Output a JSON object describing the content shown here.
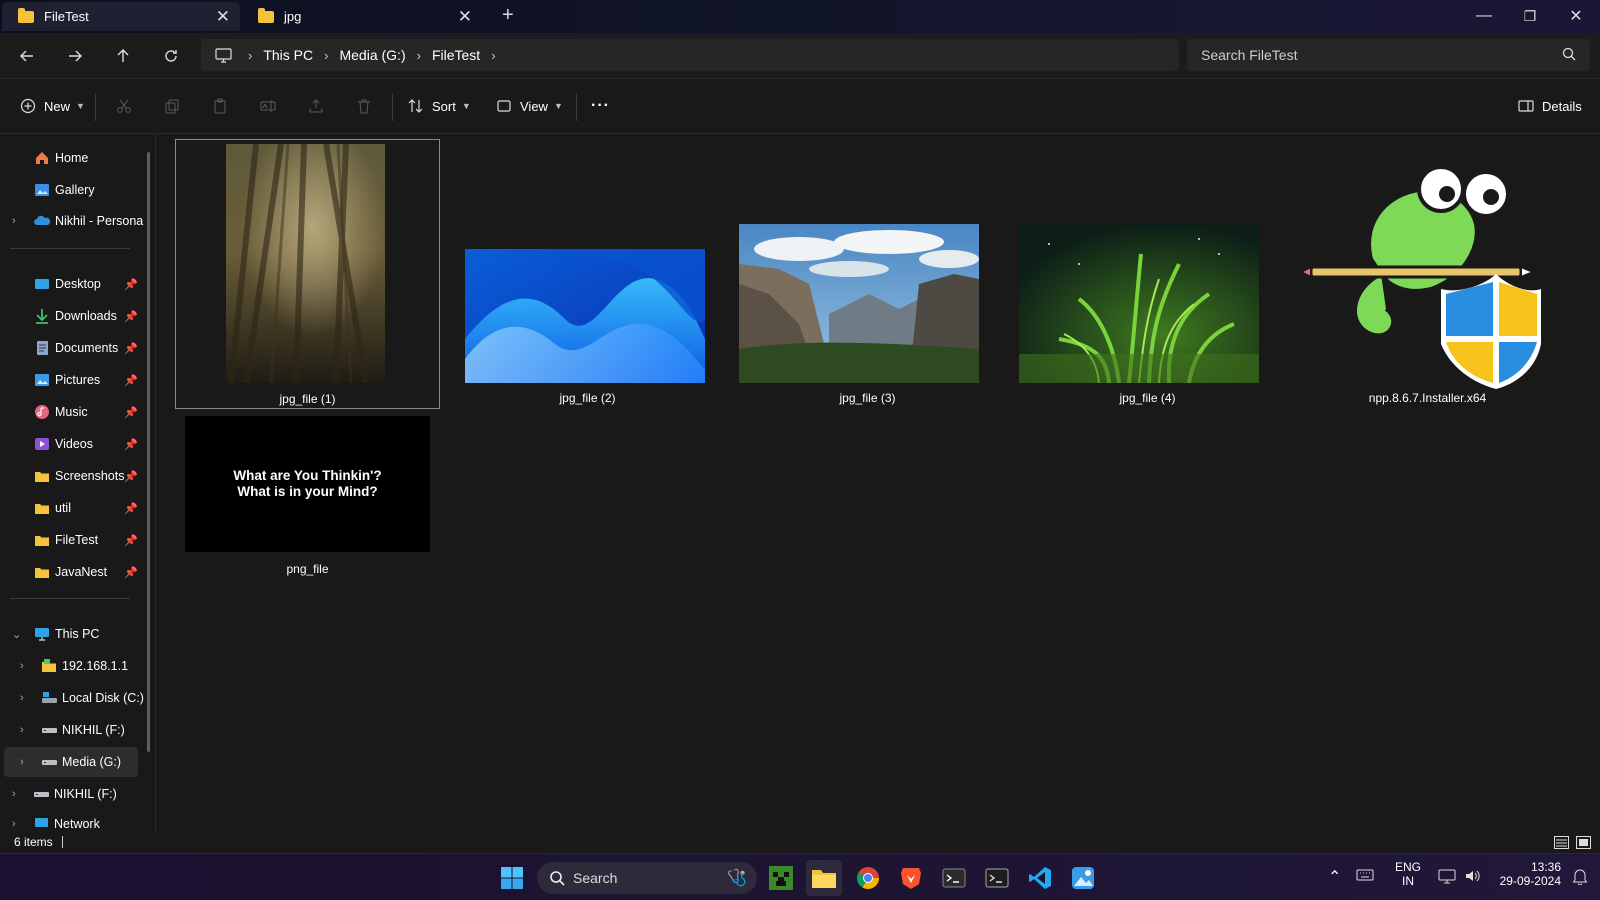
{
  "window": {
    "tabs": [
      {
        "label": "FileTest",
        "close": "✕"
      },
      {
        "label": "jpg",
        "close": "✕"
      }
    ],
    "new_tab": "+",
    "controls": {
      "minimize": "—",
      "maximize": "❐",
      "close": "✕"
    }
  },
  "address": {
    "crumbs": [
      "This PC",
      "Media (G:)",
      "FileTest"
    ],
    "separator": "›",
    "search_placeholder": "Search FileTest"
  },
  "commands": {
    "new": "New",
    "sort": "Sort",
    "view": "View",
    "more": "···",
    "details": "Details"
  },
  "sidebar": {
    "quick": [
      {
        "label": "Home",
        "icon": "home-icon"
      },
      {
        "label": "Gallery",
        "icon": "gallery-icon"
      },
      {
        "label": "Nikhil - Persona",
        "icon": "onedrive-icon"
      }
    ],
    "pinned": [
      {
        "label": "Desktop",
        "icon": "desktop-icon"
      },
      {
        "label": "Downloads",
        "icon": "downloads-icon"
      },
      {
        "label": "Documents",
        "icon": "documents-icon"
      },
      {
        "label": "Pictures",
        "icon": "pictures-icon"
      },
      {
        "label": "Music",
        "icon": "music-icon"
      },
      {
        "label": "Videos",
        "icon": "videos-icon"
      },
      {
        "label": "Screenshots",
        "icon": "folder-icon"
      },
      {
        "label": "util",
        "icon": "folder-icon"
      },
      {
        "label": "FileTest",
        "icon": "folder-icon"
      },
      {
        "label": "JavaNest",
        "icon": "folder-icon"
      }
    ],
    "this_pc": "This PC",
    "drives": [
      {
        "label": "192.168.1.1",
        "icon": "network-share-icon"
      },
      {
        "label": "Local Disk (C:)",
        "icon": "drive-icon"
      },
      {
        "label": "NIKHIL (F:)",
        "icon": "usb-drive-icon"
      },
      {
        "label": "Media (G:)",
        "icon": "usb-drive-icon"
      }
    ],
    "nikhil_root": "NIKHIL (F:)",
    "network": "Network"
  },
  "files": [
    {
      "name": "jpg_file (1)"
    },
    {
      "name": "jpg_file (2)"
    },
    {
      "name": "jpg_file (3)"
    },
    {
      "name": "jpg_file (4)"
    },
    {
      "name": "npp.8.6.7.Installer.x64"
    },
    {
      "name": "png_file",
      "caption_line1": "What are You Thinkin'?",
      "caption_line2": "What is in your Mind?"
    }
  ],
  "status": {
    "count": "6 items"
  },
  "taskbar": {
    "search": "Search",
    "lang_top": "ENG",
    "lang_bottom": "IN",
    "time": "13:36",
    "date": "29-09-2024"
  },
  "colors": {
    "folder": "#f5c33b",
    "accent": "#4cc2ff",
    "background": "#191919"
  }
}
